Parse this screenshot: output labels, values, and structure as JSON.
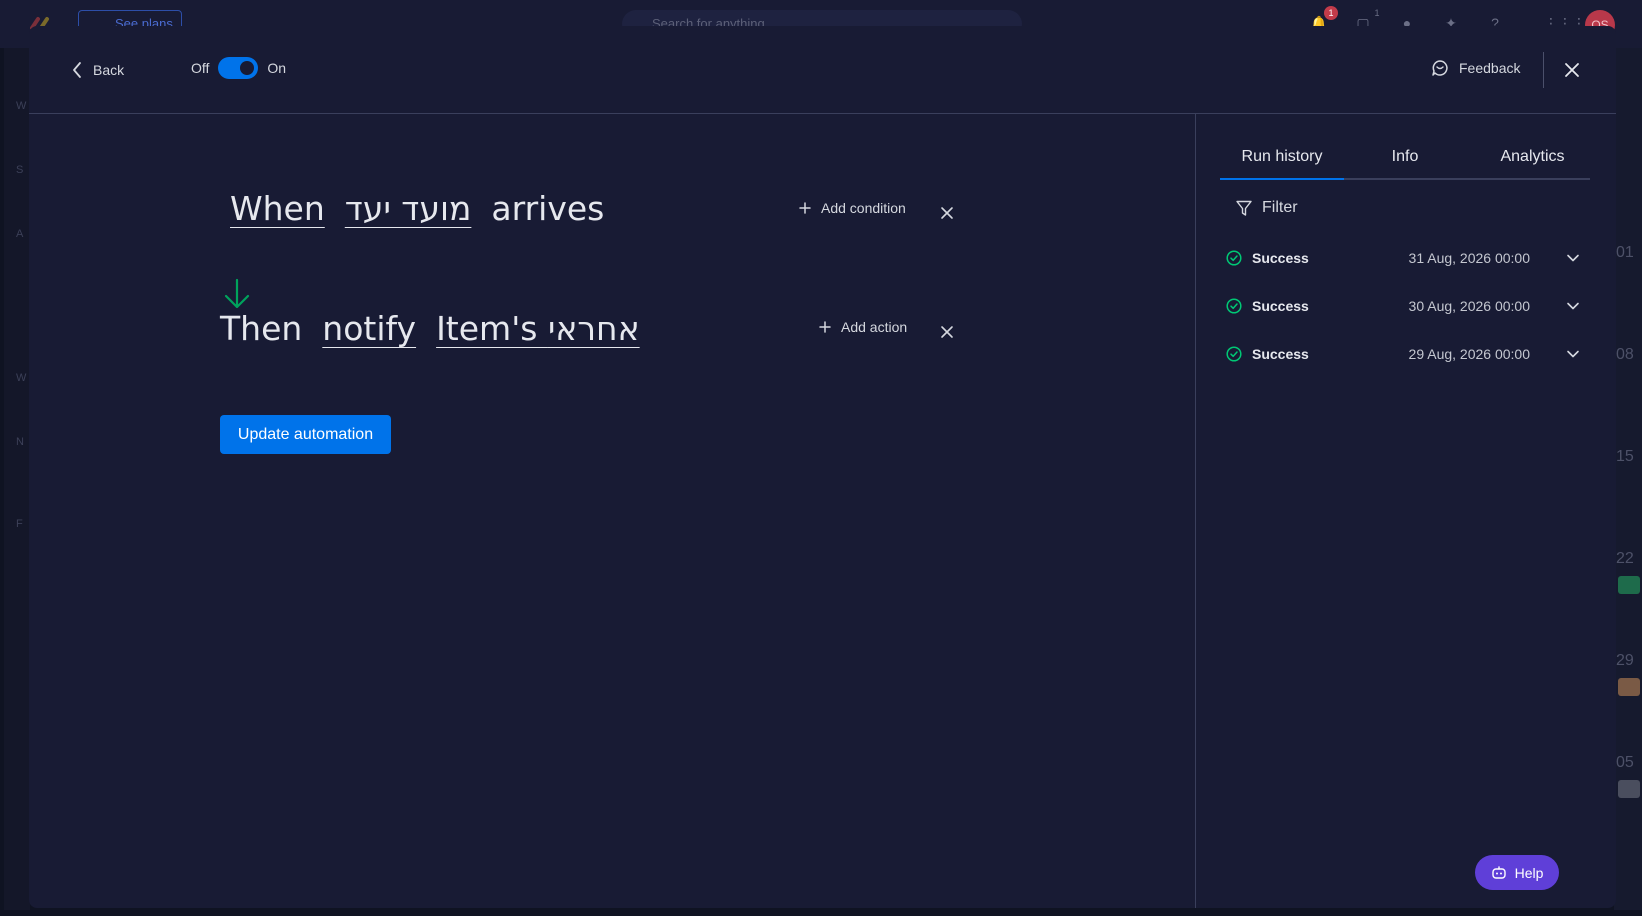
{
  "background": {
    "see_plans": "See plans",
    "search_placeholder": "Search for anything",
    "notifications_count": "1",
    "inbox_count": "1",
    "avatar_initials": "OS",
    "left_nav_letters": [
      "W",
      "S",
      "A",
      "W",
      "N",
      "F"
    ],
    "calendar_days": [
      "01",
      "08",
      "15",
      "22",
      "29",
      "05"
    ]
  },
  "header": {
    "back_label": "Back",
    "toggle_off": "Off",
    "toggle_on": "On",
    "toggle_state": "on",
    "feedback_label": "Feedback"
  },
  "recipe": {
    "trigger": {
      "when": "When",
      "field": "מועד יעד",
      "verb": "arrives"
    },
    "action": {
      "then": "Then",
      "verb": "notify",
      "target": "Item's אחראי"
    },
    "add_condition_label": "Add condition",
    "add_action_label": "Add action",
    "update_button_label": "Update automation"
  },
  "side_panel": {
    "tabs": [
      {
        "label": "Run history",
        "active": true
      },
      {
        "label": "Info",
        "active": false
      },
      {
        "label": "Analytics",
        "active": false
      }
    ],
    "filter_label": "Filter",
    "run_history": [
      {
        "status": "Success",
        "date": "31 Aug, 2026 00:00"
      },
      {
        "status": "Success",
        "date": "30 Aug, 2026 00:00"
      },
      {
        "status": "Success",
        "date": "29 Aug, 2026 00:00"
      }
    ]
  },
  "help_label": "Help",
  "colors": {
    "primary": "#0073ea",
    "success": "#00c875",
    "arrow_green": "#00a35c",
    "help_purple": "#5f3fd8",
    "modal_bg": "#181b34"
  }
}
